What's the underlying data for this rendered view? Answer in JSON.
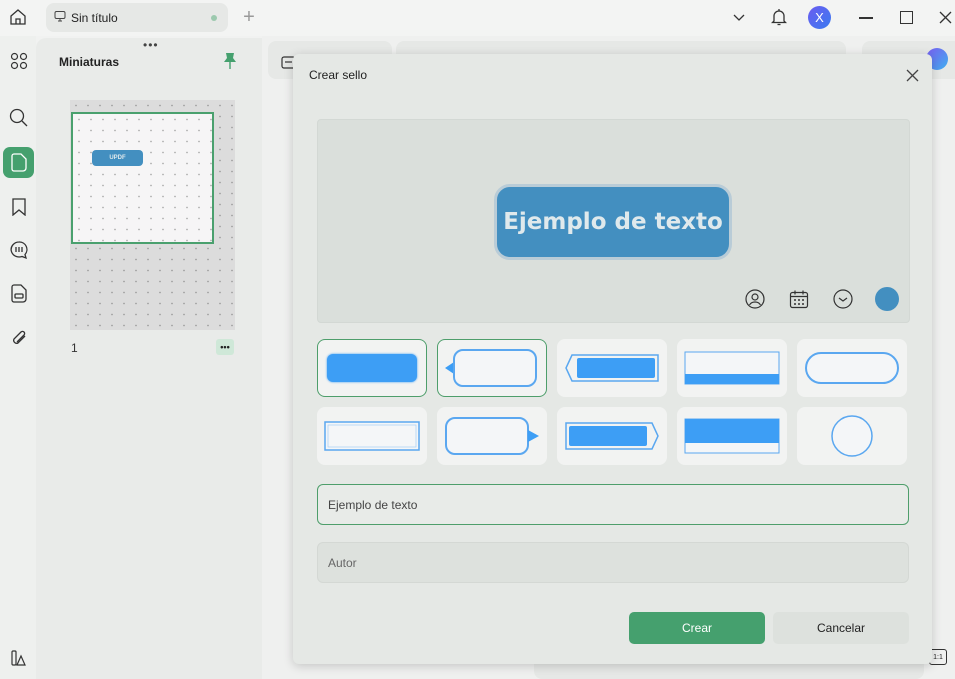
{
  "tab": {
    "title": "Sin título"
  },
  "user": {
    "avatar_letter": "X"
  },
  "sidebar": {
    "title": "Miniaturas",
    "page_number": "1",
    "thumb_stamp": "UPDF"
  },
  "dialog": {
    "title": "Crear sello",
    "preview_text": "Ejemplo de texto",
    "preview_color": "#438fc0",
    "text_value": "Ejemplo de texto",
    "author_placeholder": "Autor",
    "create_label": "Crear",
    "cancel_label": "Cancelar"
  },
  "colors": {
    "accent": "#45a06e",
    "stamp_blue": "#3d9ef5"
  }
}
